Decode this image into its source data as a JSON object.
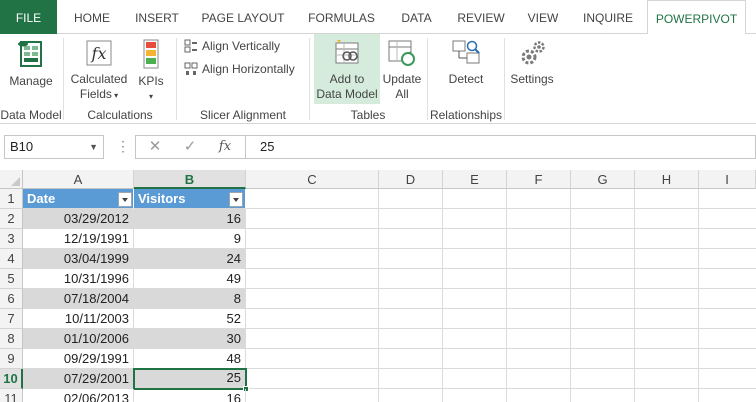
{
  "ribbon_tabs": [
    {
      "label": "FILE"
    },
    {
      "label": "HOME"
    },
    {
      "label": "INSERT"
    },
    {
      "label": "PAGE LAYOUT"
    },
    {
      "label": "FORMULAS"
    },
    {
      "label": "DATA"
    },
    {
      "label": "REVIEW"
    },
    {
      "label": "VIEW"
    },
    {
      "label": "INQUIRE"
    },
    {
      "label": "POWERPIVOT",
      "active": true
    }
  ],
  "ribbon": {
    "groups": {
      "data_model": "Data Model",
      "calculations": "Calculations",
      "slicer_alignment": "Slicer Alignment",
      "tables": "Tables",
      "relationships": "Relationships"
    },
    "buttons": {
      "manage": "Manage",
      "calculated_fields_1": "Calculated",
      "calculated_fields_2": "Fields",
      "kpis": "KPIs",
      "align_vertically": "Align Vertically",
      "align_horizontally": "Align Horizontally",
      "add_to_data_model_1": "Add to",
      "add_to_data_model_2": "Data Model",
      "update_all_1": "Update",
      "update_all_2": "All",
      "detect": "Detect",
      "settings": "Settings"
    },
    "icons": {
      "manage": "powerpivot-manage-icon",
      "calculated_fields": "fx-icon",
      "kpis": "kpi-traffic-light-icon",
      "align_vertically": "align-vertical-icon",
      "align_horizontally": "align-horizontal-icon",
      "add_to_data_model": "add-table-to-model-icon",
      "update_all": "refresh-table-icon",
      "detect": "detect-relationships-icon",
      "settings": "gear-icon"
    }
  },
  "formula_bar": {
    "name_box": "B10",
    "cancel_symbol": "✕",
    "enter_symbol": "✓",
    "function_symbol": "fx",
    "value": "25"
  },
  "columns": [
    "A",
    "B",
    "C",
    "D",
    "E",
    "F",
    "G",
    "H",
    "I"
  ],
  "selected_column": "B",
  "rows": [
    "1",
    "2",
    "3",
    "4",
    "5",
    "6",
    "7",
    "8",
    "9",
    "10",
    "11"
  ],
  "selected_row": "10",
  "table": {
    "headers": [
      "Date",
      "Visitors"
    ],
    "records": [
      [
        "03/29/2012",
        "16"
      ],
      [
        "12/19/1991",
        "9"
      ],
      [
        "03/04/1999",
        "24"
      ],
      [
        "10/31/1996",
        "49"
      ],
      [
        "07/18/2004",
        "8"
      ],
      [
        "10/11/2003",
        "52"
      ],
      [
        "01/10/2006",
        "30"
      ],
      [
        "09/29/1991",
        "48"
      ],
      [
        "07/29/2001",
        "25"
      ],
      [
        "02/06/2013",
        "16"
      ]
    ]
  },
  "colors": {
    "excel_green": "#217346",
    "table_header": "#5b9bd5",
    "band": "#d9d9d9",
    "selected_button": "#d5ecdc"
  }
}
